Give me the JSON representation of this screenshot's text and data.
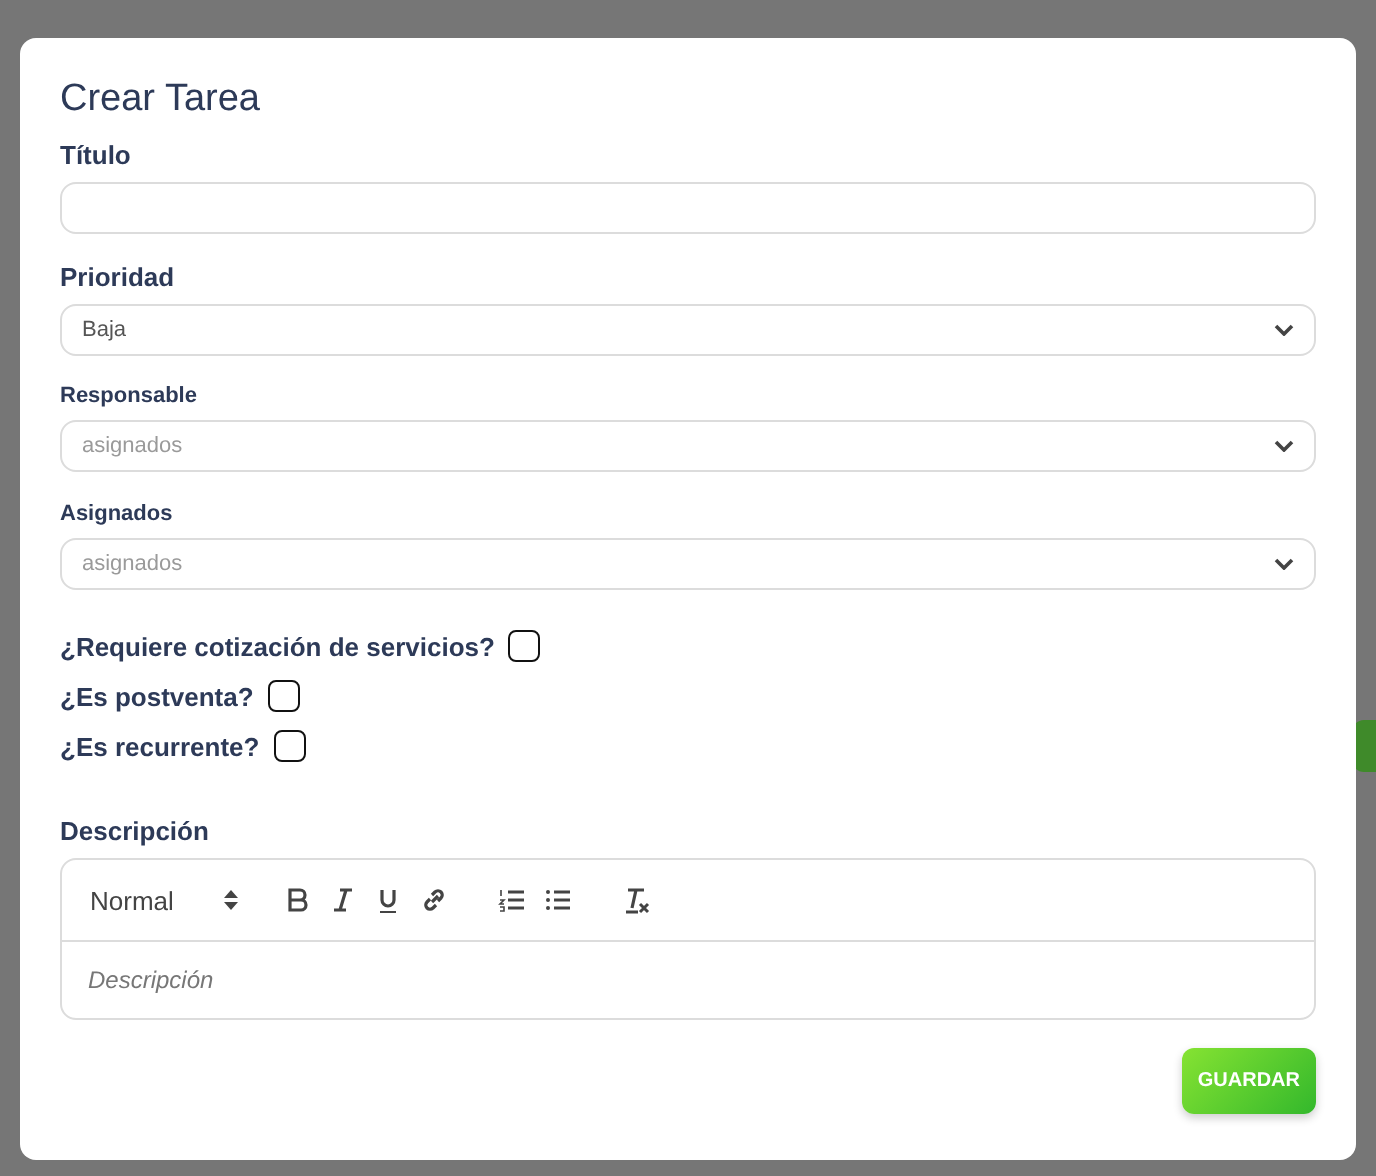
{
  "dialog": {
    "title": "Crear Tarea",
    "fields": [
      {
        "kind": "text",
        "label": "Título"
      },
      {
        "kind": "select",
        "label": "Prioridad",
        "value": "Baja"
      },
      {
        "kind": "multiselect",
        "label": "Responsable",
        "placeholder": "asignados"
      },
      {
        "kind": "multiselect",
        "label": "Asignados",
        "placeholder": "asignados"
      }
    ],
    "questions": [
      {
        "label": "¿Requiere cotización de servicios?",
        "checked": false
      },
      {
        "label": "¿Es postventa?",
        "checked": false
      },
      {
        "label": "¿Es recurrente?",
        "checked": false
      }
    ],
    "description": {
      "label": "Descripción",
      "format": "Normal",
      "placeholder": "Descripción"
    },
    "buttons": [
      {
        "label": "GUARDAR"
      }
    ]
  }
}
